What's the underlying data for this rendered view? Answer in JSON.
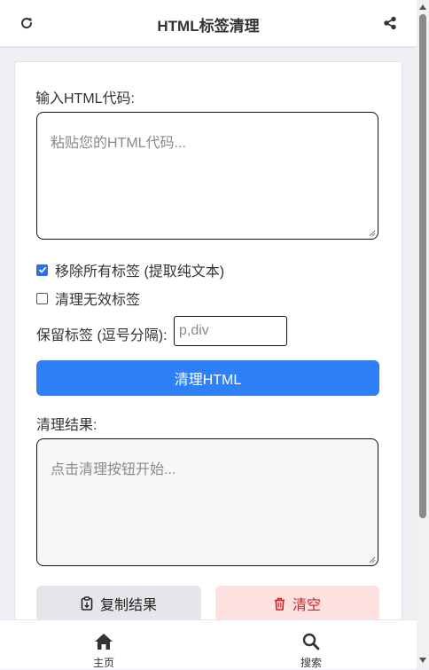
{
  "header": {
    "title": "HTML标签清理",
    "refresh_icon": "refresh-icon",
    "share_icon": "share-icon"
  },
  "input": {
    "label": "输入HTML代码:",
    "value": "",
    "placeholder": "粘贴您的HTML代码..."
  },
  "options": {
    "remove_all_label": "移除所有标签 (提取纯文本)",
    "remove_all_checked": true,
    "clean_invalid_label": "清理无效标签",
    "clean_invalid_checked": false,
    "keep_tags_label": "保留标签 (逗号分隔):",
    "keep_tags_value": "",
    "keep_tags_placeholder": "p,div"
  },
  "actions": {
    "clean_label": "清理HTML",
    "copy_label": "复制结果",
    "clear_label": "清空"
  },
  "result": {
    "label": "清理结果:",
    "placeholder": "点击清理按钮开始..."
  },
  "nav": {
    "home_label": "主页",
    "search_label": "搜索"
  },
  "colors": {
    "primary": "#2f7ff7",
    "danger_bg": "#fde0e0",
    "danger_text": "#d21f1f",
    "secondary_bg": "#e4e6e9"
  }
}
